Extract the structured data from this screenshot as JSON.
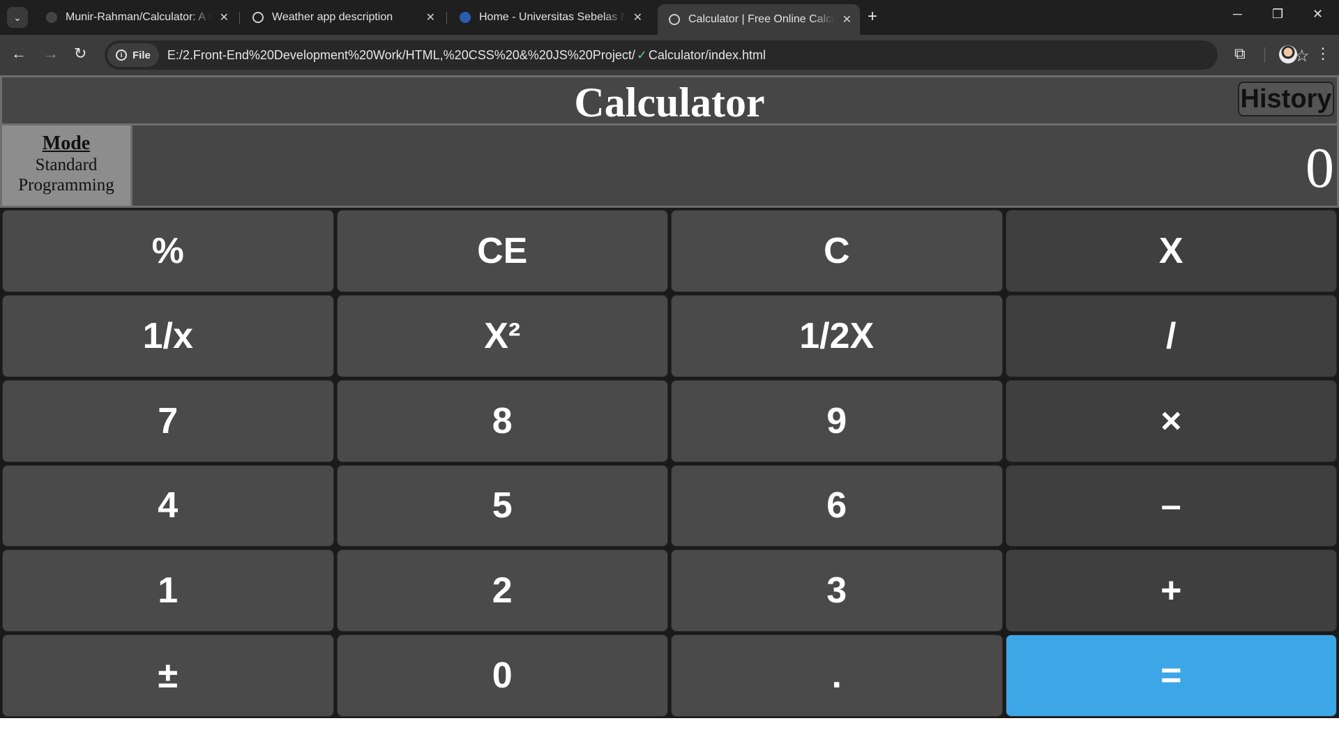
{
  "browser": {
    "tabs": [
      {
        "title": "Munir-Rahman/Calculator: A simple calculator",
        "active": false
      },
      {
        "title": "Weather app description",
        "active": false
      },
      {
        "title": "Home - Universitas Sebelas Maret",
        "active": false
      },
      {
        "title": "Calculator | Free Online Calculator",
        "active": true
      }
    ],
    "new_tab_label": "+",
    "close_glyph": "✕",
    "url_scheme_label": "File",
    "url_part1": "E:/2.Front-End%20Development%20Work/HTML,%20CSS%20&%20JS%20Project/",
    "url_check": "✓",
    "url_part2": "Calculator/index.html",
    "icons": {
      "back": "←",
      "forward": "→",
      "reload": "↻",
      "star": "☆",
      "extensions": "⧉",
      "menu": "⋮",
      "minimize": "─",
      "restore": "❐",
      "close": "✕",
      "tab_search": "⌄",
      "info": "i"
    }
  },
  "calculator": {
    "title": "Calculator",
    "history_label": "History",
    "mode": {
      "heading": "Mode",
      "options": [
        "Standard",
        "Programming"
      ]
    },
    "display_value": "0",
    "keys": [
      "%",
      "CE",
      "C",
      "X",
      "1/x",
      "X²",
      "1/2X",
      "/",
      "7",
      "8",
      "9",
      "×",
      "4",
      "5",
      "6",
      "–",
      "1",
      "2",
      "3",
      "+",
      "±",
      "0",
      ".",
      "="
    ],
    "colors": {
      "panel": "#464646",
      "key": "#4a4a4a",
      "operator_key": "#3f3f3f",
      "equals_key": "#3da6e6",
      "mode_panel": "#8d8d8d"
    }
  }
}
